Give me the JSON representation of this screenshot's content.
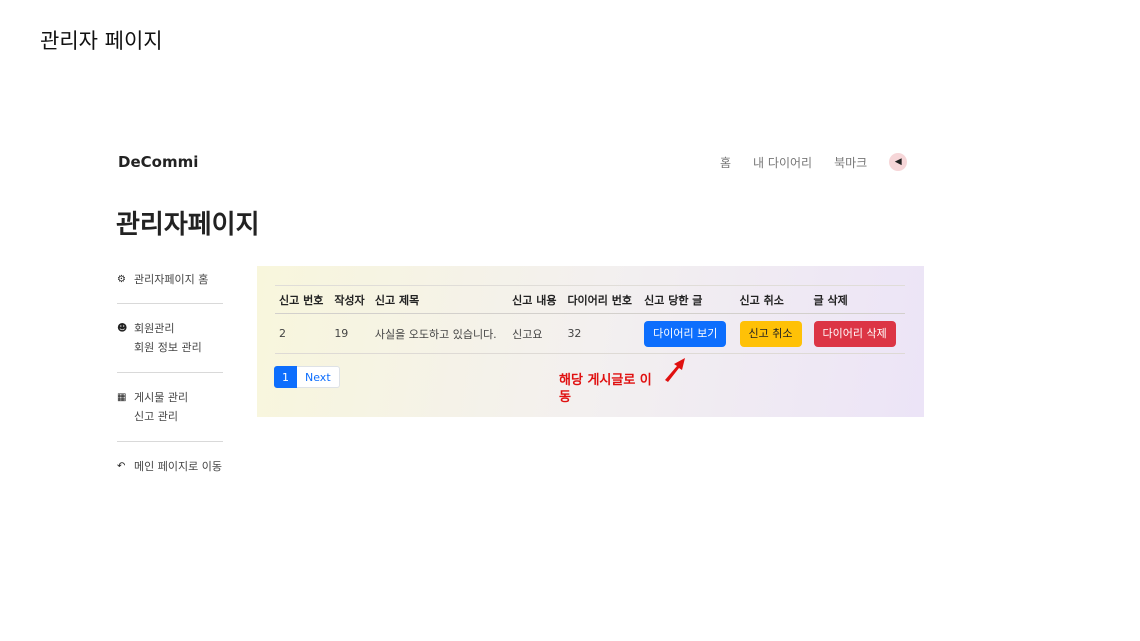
{
  "slide": {
    "title": "관리자 페이지"
  },
  "header": {
    "brand": "DeCommi",
    "nav": [
      "홈",
      "내 다이어리",
      "북마크"
    ],
    "back_icon": "caret-left-icon"
  },
  "page": {
    "title": "관리자페이지"
  },
  "sidebar": {
    "home": {
      "icon": "gear-icon",
      "label": "관리자페이지 홈"
    },
    "member": {
      "icon": "users-icon",
      "label": "회원관리",
      "sub": "회원 정보 관리"
    },
    "board": {
      "icon": "grid-icon",
      "label": "게시물 관리",
      "sub": "신고 관리"
    },
    "main": {
      "icon": "reply-arrow-icon",
      "label": "메인 페이지로 이동"
    }
  },
  "table": {
    "headers": [
      "신고 번호",
      "작성자",
      "신고 제목",
      "신고 내용",
      "다이어리 번호",
      "신고 당한 글",
      "신고 취소",
      "글 삭제"
    ],
    "rows": [
      {
        "id": "2",
        "writer": "19",
        "title": "사실을 오도하고 있습니다.",
        "content": "신고요",
        "diary_no": "32",
        "view_label": "다이어리 보기",
        "cancel_label": "신고 취소",
        "delete_label": "다이어리 삭제"
      }
    ]
  },
  "pagination": {
    "current": "1",
    "next": "Next"
  },
  "annotation": {
    "text": "해당 게시글로 이동",
    "color": "#e01010"
  },
  "colors": {
    "primary": "#0d6efd",
    "warning": "#ffc107",
    "danger": "#dc3545"
  }
}
